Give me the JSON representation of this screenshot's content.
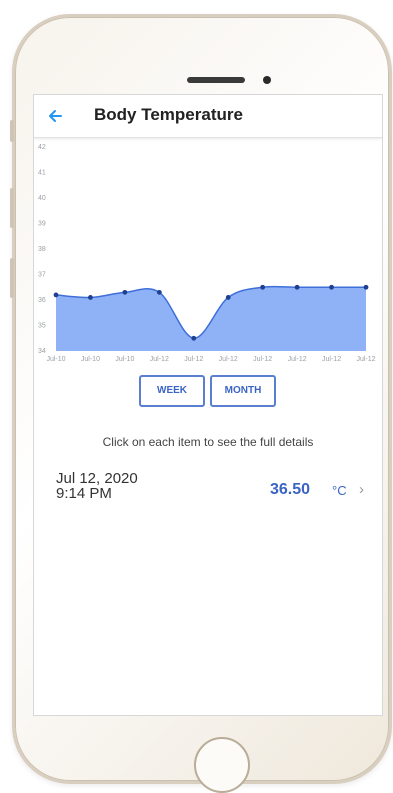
{
  "header": {
    "title": "Body Temperature",
    "back_icon": "arrow-left-icon"
  },
  "chart_data": {
    "type": "area",
    "title": "",
    "xlabel": "",
    "ylabel": "",
    "ylim": [
      34,
      42
    ],
    "yticks": [
      34,
      35,
      36,
      37,
      38,
      39,
      40,
      41,
      42
    ],
    "categories": [
      "Jul-10",
      "Jul-10",
      "Jul-10",
      "Jul-12",
      "Jul-12",
      "Jul-12",
      "Jul-12",
      "Jul-12",
      "Jul-12",
      "Jul-12"
    ],
    "values": [
      36.2,
      36.1,
      36.3,
      36.3,
      34.5,
      36.1,
      36.5,
      36.5,
      36.5,
      36.5
    ],
    "fill_color": "#8fb2f7",
    "line_color": "#3e6fd9",
    "point_color": "#1f3f8f",
    "grid": false
  },
  "range": {
    "week_label": "WEEK",
    "month_label": "MONTH"
  },
  "instruction": "Click on each item to see the full details",
  "reading": {
    "date": "Jul 12, 2020",
    "time": "9:14 PM",
    "value": "36.50",
    "unit": "°C",
    "chevron": "›"
  },
  "colors": {
    "accent": "#3a64c4",
    "back_arrow": "#2196f3"
  }
}
